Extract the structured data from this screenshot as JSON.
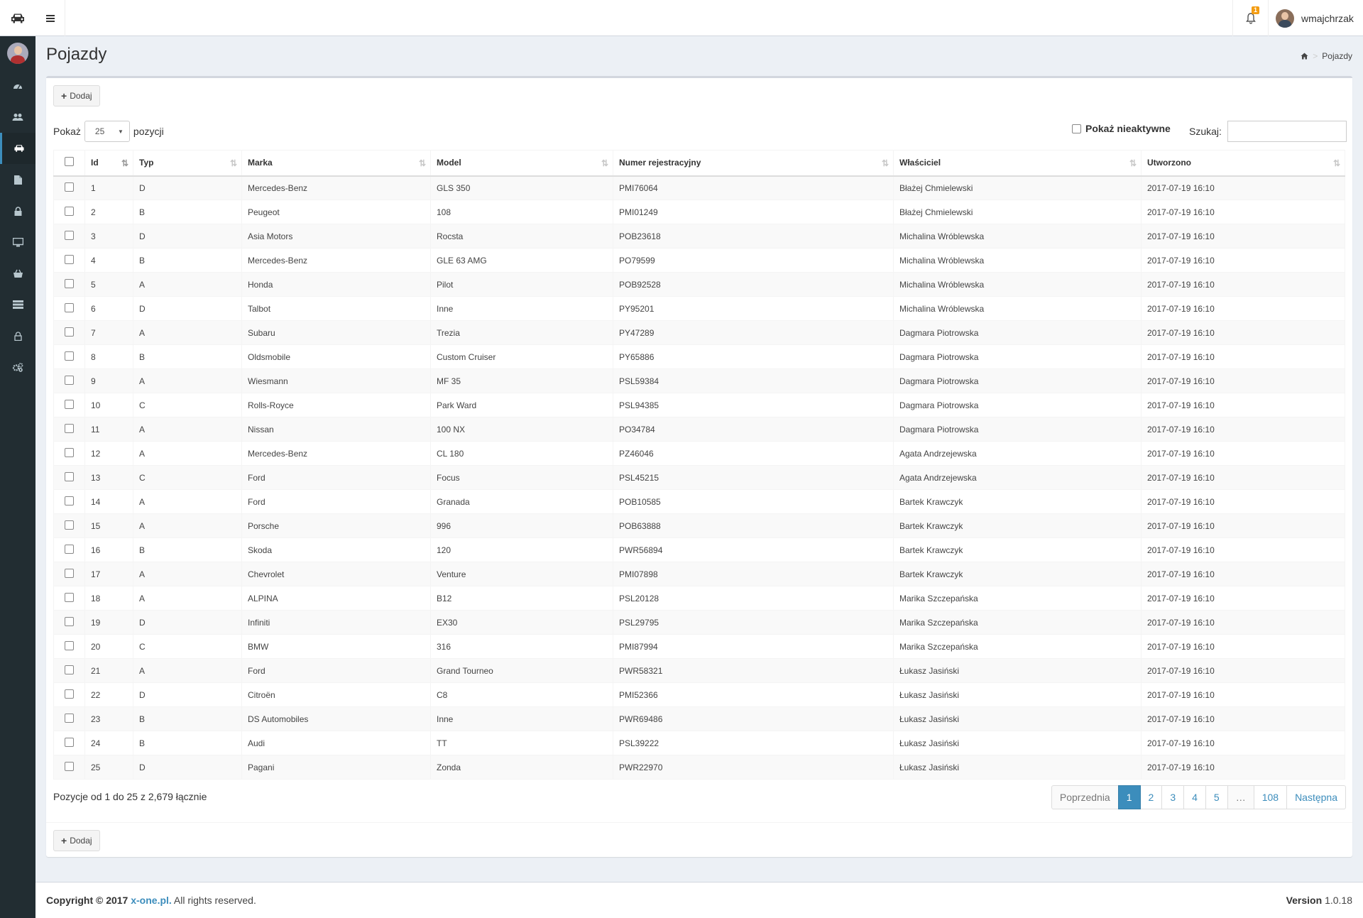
{
  "header": {
    "logo_icon": "car-icon",
    "user_name": "wmajchrzak",
    "notification_count": "1"
  },
  "sidebar": {
    "items": [
      {
        "icon": "dashboard-icon",
        "active": false
      },
      {
        "icon": "users-icon",
        "active": false
      },
      {
        "icon": "car-icon",
        "active": true
      },
      {
        "icon": "document-icon",
        "active": false
      },
      {
        "icon": "lock-icon",
        "active": false
      },
      {
        "icon": "monitor-icon",
        "active": false
      },
      {
        "icon": "basket-icon",
        "active": false
      },
      {
        "icon": "server-icon",
        "active": false
      },
      {
        "icon": "user-lock-icon",
        "active": false
      },
      {
        "icon": "cogs-icon",
        "active": false
      }
    ]
  },
  "page": {
    "title": "Pojazdy",
    "breadcrumb": "Pojazdy"
  },
  "toolbar": {
    "add_label": "Dodaj",
    "show_label": "Pokaż",
    "page_size": "25",
    "entries_label": "pozycji",
    "inactive_label": "Pokaż nieaktywne",
    "search_label": "Szukaj:",
    "search_value": ""
  },
  "table": {
    "columns": [
      "Id",
      "Typ",
      "Marka",
      "Model",
      "Numer rejestracyjny",
      "Właściciel",
      "Utworzono"
    ],
    "rows": [
      [
        "1",
        "D",
        "Mercedes-Benz",
        "GLS 350",
        "PMI76064",
        "Błażej Chmielewski",
        "2017-07-19 16:10"
      ],
      [
        "2",
        "B",
        "Peugeot",
        "108",
        "PMI01249",
        "Błażej Chmielewski",
        "2017-07-19 16:10"
      ],
      [
        "3",
        "D",
        "Asia Motors",
        "Rocsta",
        "POB23618",
        "Michalina Wróblewska",
        "2017-07-19 16:10"
      ],
      [
        "4",
        "B",
        "Mercedes-Benz",
        "GLE 63 AMG",
        "PO79599",
        "Michalina Wróblewska",
        "2017-07-19 16:10"
      ],
      [
        "5",
        "A",
        "Honda",
        "Pilot",
        "POB92528",
        "Michalina Wróblewska",
        "2017-07-19 16:10"
      ],
      [
        "6",
        "D",
        "Talbot",
        "Inne",
        "PY95201",
        "Michalina Wróblewska",
        "2017-07-19 16:10"
      ],
      [
        "7",
        "A",
        "Subaru",
        "Trezia",
        "PY47289",
        "Dagmara Piotrowska",
        "2017-07-19 16:10"
      ],
      [
        "8",
        "B",
        "Oldsmobile",
        "Custom Cruiser",
        "PY65886",
        "Dagmara Piotrowska",
        "2017-07-19 16:10"
      ],
      [
        "9",
        "A",
        "Wiesmann",
        "MF 35",
        "PSL59384",
        "Dagmara Piotrowska",
        "2017-07-19 16:10"
      ],
      [
        "10",
        "C",
        "Rolls-Royce",
        "Park Ward",
        "PSL94385",
        "Dagmara Piotrowska",
        "2017-07-19 16:10"
      ],
      [
        "11",
        "A",
        "Nissan",
        "100 NX",
        "PO34784",
        "Dagmara Piotrowska",
        "2017-07-19 16:10"
      ],
      [
        "12",
        "A",
        "Mercedes-Benz",
        "CL 180",
        "PZ46046",
        "Agata Andrzejewska",
        "2017-07-19 16:10"
      ],
      [
        "13",
        "C",
        "Ford",
        "Focus",
        "PSL45215",
        "Agata Andrzejewska",
        "2017-07-19 16:10"
      ],
      [
        "14",
        "A",
        "Ford",
        "Granada",
        "POB10585",
        "Bartek Krawczyk",
        "2017-07-19 16:10"
      ],
      [
        "15",
        "A",
        "Porsche",
        "996",
        "POB63888",
        "Bartek Krawczyk",
        "2017-07-19 16:10"
      ],
      [
        "16",
        "B",
        "Skoda",
        "120",
        "PWR56894",
        "Bartek Krawczyk",
        "2017-07-19 16:10"
      ],
      [
        "17",
        "A",
        "Chevrolet",
        "Venture",
        "PMI07898",
        "Bartek Krawczyk",
        "2017-07-19 16:10"
      ],
      [
        "18",
        "A",
        "ALPINA",
        "B12",
        "PSL20128",
        "Marika Szczepańska",
        "2017-07-19 16:10"
      ],
      [
        "19",
        "D",
        "Infiniti",
        "EX30",
        "PSL29795",
        "Marika Szczepańska",
        "2017-07-19 16:10"
      ],
      [
        "20",
        "C",
        "BMW",
        "316",
        "PMI87994",
        "Marika Szczepańska",
        "2017-07-19 16:10"
      ],
      [
        "21",
        "A",
        "Ford",
        "Grand Tourneo",
        "PWR58321",
        "Łukasz Jasiński",
        "2017-07-19 16:10"
      ],
      [
        "22",
        "D",
        "Citroën",
        "C8",
        "PMI52366",
        "Łukasz Jasiński",
        "2017-07-19 16:10"
      ],
      [
        "23",
        "B",
        "DS Automobiles",
        "Inne",
        "PWR69486",
        "Łukasz Jasiński",
        "2017-07-19 16:10"
      ],
      [
        "24",
        "B",
        "Audi",
        "TT",
        "PSL39222",
        "Łukasz Jasiński",
        "2017-07-19 16:10"
      ],
      [
        "25",
        "D",
        "Pagani",
        "Zonda",
        "PWR22970",
        "Łukasz Jasiński",
        "2017-07-19 16:10"
      ]
    ]
  },
  "pagination": {
    "info": "Pozycje od 1 do 25 z 2,679 łącznie",
    "prev": "Poprzednia",
    "pages": [
      "1",
      "2",
      "3",
      "4",
      "5",
      "…",
      "108"
    ],
    "current": "1",
    "next": "Następna"
  },
  "footer": {
    "copyright_prefix": "Copyright © 2017",
    "company": "x-one.pl.",
    "rights": "All rights reserved.",
    "version_label": "Version",
    "version": "1.0.18"
  },
  "colors": {
    "accent": "#3c8dbc",
    "sidebar_bg": "#222d32",
    "badge": "#f39c12"
  }
}
